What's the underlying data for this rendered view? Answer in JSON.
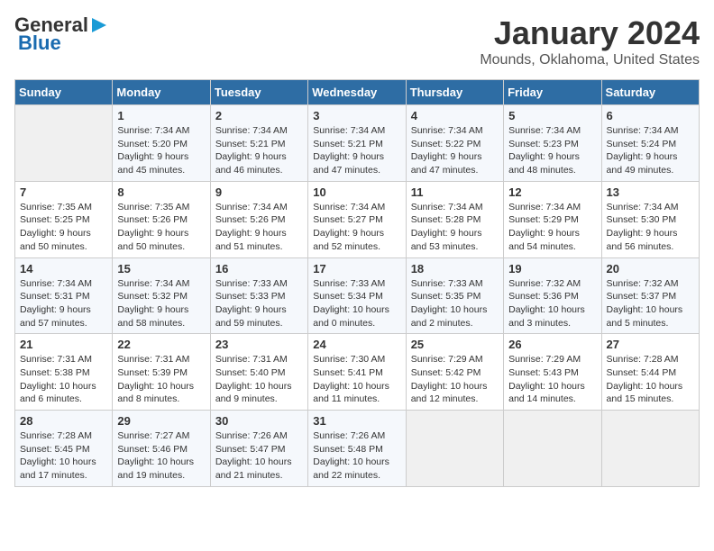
{
  "header": {
    "logo_line1": "General",
    "logo_line2": "Blue",
    "title": "January 2024",
    "subtitle": "Mounds, Oklahoma, United States"
  },
  "weekdays": [
    "Sunday",
    "Monday",
    "Tuesday",
    "Wednesday",
    "Thursday",
    "Friday",
    "Saturday"
  ],
  "weeks": [
    [
      {
        "day": "",
        "info": ""
      },
      {
        "day": "1",
        "info": "Sunrise: 7:34 AM\nSunset: 5:20 PM\nDaylight: 9 hours\nand 45 minutes."
      },
      {
        "day": "2",
        "info": "Sunrise: 7:34 AM\nSunset: 5:21 PM\nDaylight: 9 hours\nand 46 minutes."
      },
      {
        "day": "3",
        "info": "Sunrise: 7:34 AM\nSunset: 5:21 PM\nDaylight: 9 hours\nand 47 minutes."
      },
      {
        "day": "4",
        "info": "Sunrise: 7:34 AM\nSunset: 5:22 PM\nDaylight: 9 hours\nand 47 minutes."
      },
      {
        "day": "5",
        "info": "Sunrise: 7:34 AM\nSunset: 5:23 PM\nDaylight: 9 hours\nand 48 minutes."
      },
      {
        "day": "6",
        "info": "Sunrise: 7:34 AM\nSunset: 5:24 PM\nDaylight: 9 hours\nand 49 minutes."
      }
    ],
    [
      {
        "day": "7",
        "info": "Sunrise: 7:35 AM\nSunset: 5:25 PM\nDaylight: 9 hours\nand 50 minutes."
      },
      {
        "day": "8",
        "info": "Sunrise: 7:35 AM\nSunset: 5:26 PM\nDaylight: 9 hours\nand 50 minutes."
      },
      {
        "day": "9",
        "info": "Sunrise: 7:34 AM\nSunset: 5:26 PM\nDaylight: 9 hours\nand 51 minutes."
      },
      {
        "day": "10",
        "info": "Sunrise: 7:34 AM\nSunset: 5:27 PM\nDaylight: 9 hours\nand 52 minutes."
      },
      {
        "day": "11",
        "info": "Sunrise: 7:34 AM\nSunset: 5:28 PM\nDaylight: 9 hours\nand 53 minutes."
      },
      {
        "day": "12",
        "info": "Sunrise: 7:34 AM\nSunset: 5:29 PM\nDaylight: 9 hours\nand 54 minutes."
      },
      {
        "day": "13",
        "info": "Sunrise: 7:34 AM\nSunset: 5:30 PM\nDaylight: 9 hours\nand 56 minutes."
      }
    ],
    [
      {
        "day": "14",
        "info": "Sunrise: 7:34 AM\nSunset: 5:31 PM\nDaylight: 9 hours\nand 57 minutes."
      },
      {
        "day": "15",
        "info": "Sunrise: 7:34 AM\nSunset: 5:32 PM\nDaylight: 9 hours\nand 58 minutes."
      },
      {
        "day": "16",
        "info": "Sunrise: 7:33 AM\nSunset: 5:33 PM\nDaylight: 9 hours\nand 59 minutes."
      },
      {
        "day": "17",
        "info": "Sunrise: 7:33 AM\nSunset: 5:34 PM\nDaylight: 10 hours\nand 0 minutes."
      },
      {
        "day": "18",
        "info": "Sunrise: 7:33 AM\nSunset: 5:35 PM\nDaylight: 10 hours\nand 2 minutes."
      },
      {
        "day": "19",
        "info": "Sunrise: 7:32 AM\nSunset: 5:36 PM\nDaylight: 10 hours\nand 3 minutes."
      },
      {
        "day": "20",
        "info": "Sunrise: 7:32 AM\nSunset: 5:37 PM\nDaylight: 10 hours\nand 5 minutes."
      }
    ],
    [
      {
        "day": "21",
        "info": "Sunrise: 7:31 AM\nSunset: 5:38 PM\nDaylight: 10 hours\nand 6 minutes."
      },
      {
        "day": "22",
        "info": "Sunrise: 7:31 AM\nSunset: 5:39 PM\nDaylight: 10 hours\nand 8 minutes."
      },
      {
        "day": "23",
        "info": "Sunrise: 7:31 AM\nSunset: 5:40 PM\nDaylight: 10 hours\nand 9 minutes."
      },
      {
        "day": "24",
        "info": "Sunrise: 7:30 AM\nSunset: 5:41 PM\nDaylight: 10 hours\nand 11 minutes."
      },
      {
        "day": "25",
        "info": "Sunrise: 7:29 AM\nSunset: 5:42 PM\nDaylight: 10 hours\nand 12 minutes."
      },
      {
        "day": "26",
        "info": "Sunrise: 7:29 AM\nSunset: 5:43 PM\nDaylight: 10 hours\nand 14 minutes."
      },
      {
        "day": "27",
        "info": "Sunrise: 7:28 AM\nSunset: 5:44 PM\nDaylight: 10 hours\nand 15 minutes."
      }
    ],
    [
      {
        "day": "28",
        "info": "Sunrise: 7:28 AM\nSunset: 5:45 PM\nDaylight: 10 hours\nand 17 minutes."
      },
      {
        "day": "29",
        "info": "Sunrise: 7:27 AM\nSunset: 5:46 PM\nDaylight: 10 hours\nand 19 minutes."
      },
      {
        "day": "30",
        "info": "Sunrise: 7:26 AM\nSunset: 5:47 PM\nDaylight: 10 hours\nand 21 minutes."
      },
      {
        "day": "31",
        "info": "Sunrise: 7:26 AM\nSunset: 5:48 PM\nDaylight: 10 hours\nand 22 minutes."
      },
      {
        "day": "",
        "info": ""
      },
      {
        "day": "",
        "info": ""
      },
      {
        "day": "",
        "info": ""
      }
    ]
  ]
}
